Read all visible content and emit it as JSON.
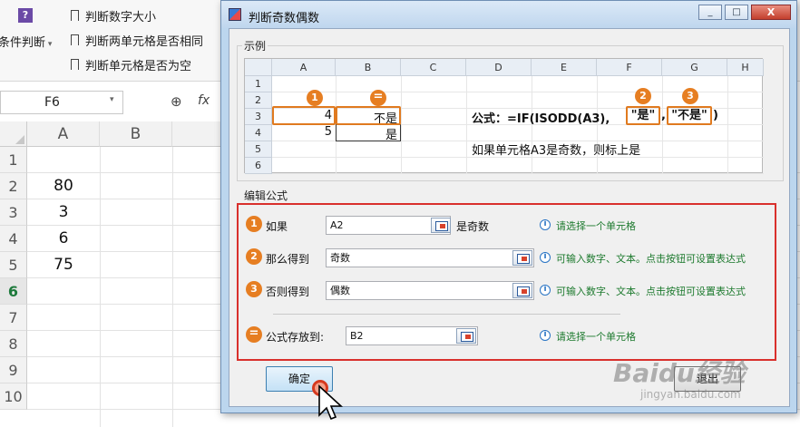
{
  "ribbon": {
    "cond_label": "条件判断",
    "items": [
      {
        "label": "判断数字大小"
      },
      {
        "label": "判断两单元格是否相同"
      },
      {
        "label": "判断单元格是否为空"
      }
    ]
  },
  "namebox": {
    "value": "F6"
  },
  "formula_bar": {
    "fx": "fx"
  },
  "sheet": {
    "columns": [
      "A",
      "B"
    ],
    "rows": [
      "1",
      "2",
      "3",
      "4",
      "5",
      "6",
      "7",
      "8",
      "9",
      "10"
    ],
    "active_row": "6",
    "values_a": [
      "",
      "80",
      "3",
      "6",
      "75",
      "",
      "",
      "",
      "",
      ""
    ]
  },
  "dialog": {
    "title": "判断奇数偶数",
    "minimize": "_",
    "maximize": "□",
    "close": "X",
    "example_label": "示例",
    "example": {
      "columns": [
        "A",
        "B",
        "C",
        "D",
        "E",
        "F",
        "G",
        "H"
      ],
      "rows": [
        "1",
        "2",
        "3",
        "4",
        "5",
        "6"
      ],
      "a3": "4",
      "b3": "不是",
      "a4": "5",
      "b4": "是",
      "badge1": "1",
      "badge_eq": "=",
      "badge2": "2",
      "badge3": "3",
      "formula_prefix": "公式：=IF(ISODD(A3),",
      "formula_arg2": "\"是\"",
      "formula_comma": ",",
      "formula_arg3": "\"不是\"",
      "formula_suffix": ")",
      "description": "如果单元格A3是奇数，则标上是"
    },
    "edit_label": "编辑公式",
    "fields": [
      {
        "badge": "1",
        "label": "如果",
        "value": "A2",
        "suffix": "是奇数",
        "hint": "请选择一个单元格"
      },
      {
        "badge": "2",
        "label": "那么得到",
        "value": "奇数",
        "suffix": "",
        "hint": "可输入数字、文本。点击按钮可设置表达式"
      },
      {
        "badge": "3",
        "label": "否则得到",
        "value": "偶数",
        "suffix": "",
        "hint": "可输入数字、文本。点击按钮可设置表达式"
      },
      {
        "badge": "=",
        "label": "公式存放到:",
        "value": "B2",
        "suffix": "",
        "hint": "请选择一个单元格"
      }
    ],
    "ok_label": "确定",
    "cancel_label": "退出"
  },
  "watermark": {
    "brand": "Baidu经验",
    "url": "jingyan.baidu.com"
  },
  "colors": {
    "accent_orange": "#e67e22",
    "red_frame": "#d9302c",
    "hint_green": "#1d7a2e",
    "info_blue": "#2874c4"
  }
}
